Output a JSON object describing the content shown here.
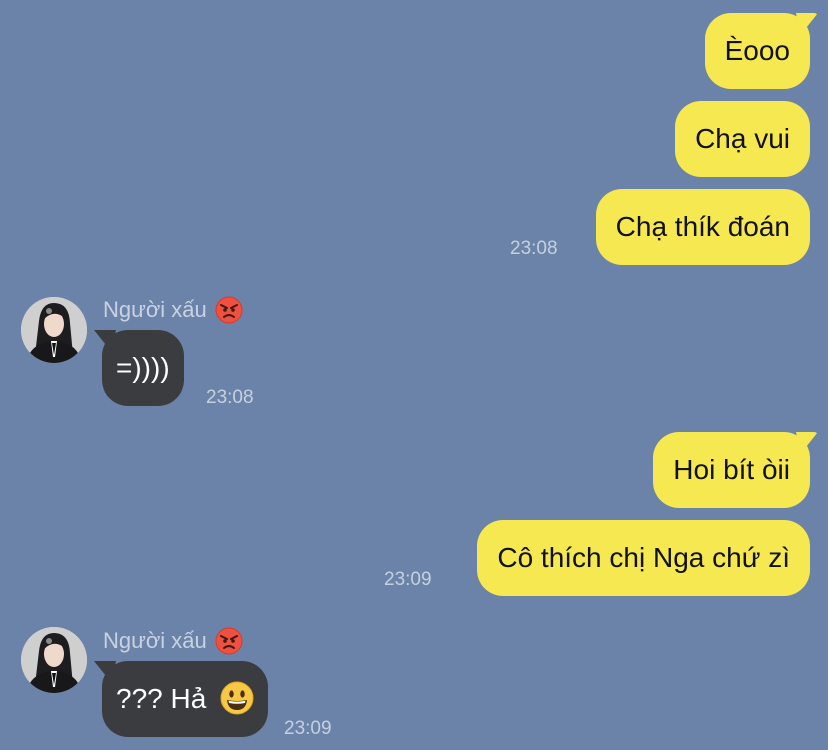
{
  "messages": {
    "out1": {
      "text": "Èooo"
    },
    "out2": {
      "text": "Chạ vui"
    },
    "out3": {
      "text": "Chạ thík đoán",
      "time": "23:08"
    },
    "in1": {
      "sender": "Người xấu",
      "sender_emoji": "angry-face",
      "text": "=))))",
      "time": "23:08"
    },
    "out4": {
      "text": "Hoi bít òii"
    },
    "out5": {
      "text": "Cô thích chị Nga chứ zì",
      "time": "23:09"
    },
    "in2": {
      "sender": "Người xấu",
      "sender_emoji": "angry-face",
      "text": "??? Hả",
      "text_emoji": "smiling-face",
      "time": "23:09"
    }
  },
  "colors": {
    "background": "#6b83a8",
    "outgoing_bubble": "#f6e851",
    "incoming_bubble": "#3a3c40",
    "timestamp": "#c5d0e0"
  }
}
